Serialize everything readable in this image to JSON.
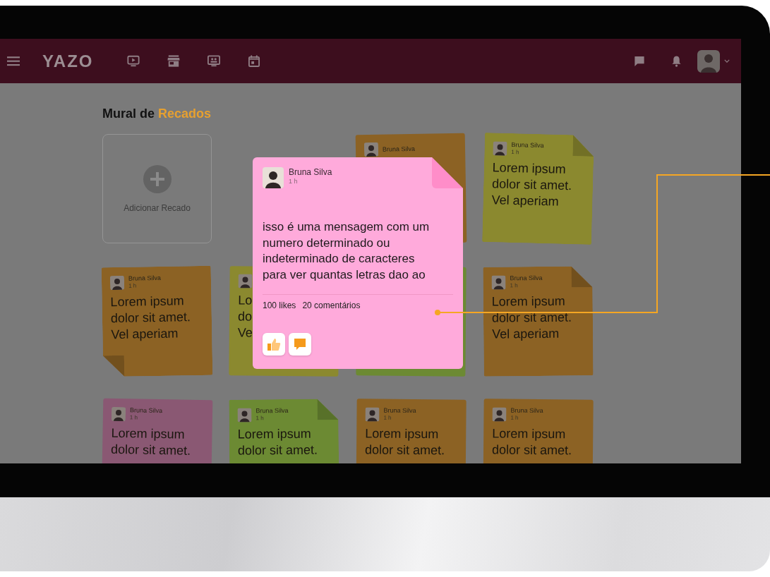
{
  "navbar": {
    "logo": "YAZO"
  },
  "page": {
    "title": "Mural de",
    "title_highlight": "Recados"
  },
  "add_card": {
    "label": "Adicionar Recado"
  },
  "notes": [
    {
      "color": "#8c6224",
      "author": "Bruna Silva"
    },
    {
      "color": "#8b892f",
      "author": "Bruna Silva",
      "time": "1 h",
      "lines": [
        "Lorem ipsum",
        "dolor sit amet.",
        "Vel aperiam"
      ],
      "fold_top_right": true
    },
    {
      "color": "#8c6224",
      "author": "Bruna Silva",
      "time": "1 h",
      "lines": [
        "Lorem ipsum",
        "dolor sit amet.",
        "Vel aperiam"
      ],
      "fold_bottom_left": true
    },
    {
      "color": "#8b892f",
      "lines": [
        "Lo",
        "do",
        "Ve"
      ]
    },
    {
      "color": "#6c8a33"
    },
    {
      "color": "#8c6224",
      "author": "Bruna Silva",
      "time": "1 h",
      "lines": [
        "Lorem ipsum",
        "dolor sit amet.",
        "Vel aperiam"
      ],
      "fold_top_right": true
    },
    {
      "color": "#8a5873",
      "author": "Bruna Silva",
      "time": "1 h",
      "lines": [
        "Lorem ipsum",
        "dolor sit amet."
      ]
    },
    {
      "color": "#6c8a33",
      "author": "Bruna Silva",
      "time": "1 h",
      "lines": [
        "Lorem ipsum",
        "dolor sit amet."
      ],
      "fold_top_right": true
    },
    {
      "color": "#8c6224",
      "author": "Bruna Silva",
      "time": "1 h",
      "lines": [
        "Lorem ipsum",
        "dolor sit amet."
      ]
    },
    {
      "color": "#8c6224",
      "author": "Bruna Silva",
      "time": "1 h",
      "lines": [
        "Lorem ipsum",
        "dolor sit amet."
      ]
    }
  ],
  "popup": {
    "author": "Bruna Silva",
    "time": "1 h",
    "message": "isso é uma mensagem com um numero determinado ou indeterminado de caracteres para ver quantas letras dao ao",
    "likes": "100 likes",
    "comments": "20 comentários"
  }
}
